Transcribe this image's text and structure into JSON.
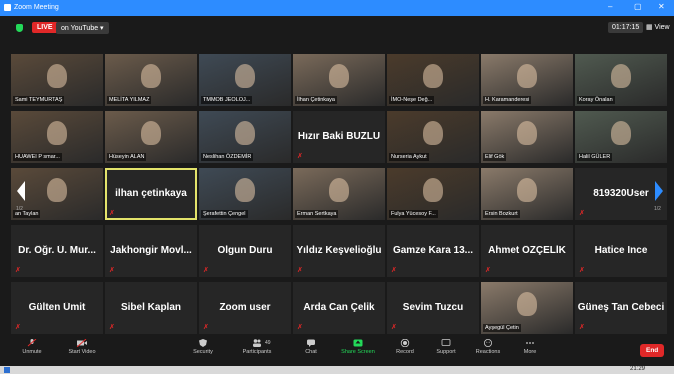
{
  "window": {
    "title": "Zoom Meeting"
  },
  "topbar": {
    "live": "LIVE",
    "stream": "on YouTube ▾",
    "timer": "01:17:15",
    "view": "▦ View"
  },
  "page_indicator_left": "1/2",
  "page_indicator_right": "1/2",
  "tiles": [
    {
      "name": "Sami TEYMURTAŞ",
      "photo": true
    },
    {
      "name": "MELİTA YILMAZ",
      "photo": true
    },
    {
      "name": "TMMOB JEOLOJ...",
      "photo": true
    },
    {
      "name": "İlhan Çetinkaya",
      "photo": true
    },
    {
      "name": "İMO-Neşe Değ...",
      "photo": true
    },
    {
      "name": "H. Karamanderesi",
      "photo": true
    },
    {
      "name": "Koray Önalan",
      "photo": true
    },
    {
      "name": "HUAWEI P smar...",
      "photo": true
    },
    {
      "name": "Hüseyin ALAN",
      "photo": true
    },
    {
      "name": "Neslihan ÖZDEMİR",
      "photo": true
    },
    {
      "name": "Hızır Baki BUZLU",
      "photo": false
    },
    {
      "name": "Nurseria Aykut",
      "photo": true
    },
    {
      "name": "Elif Gök",
      "photo": true
    },
    {
      "name": "Halil GÜLER",
      "photo": true
    },
    {
      "name": "an Taylan",
      "photo": true
    },
    {
      "name": "ilhan çetinkaya",
      "photo": false
    },
    {
      "name": "Şerafettin Çengel",
      "photo": true
    },
    {
      "name": "Erman Sertkaya",
      "photo": true
    },
    {
      "name": "Fulya Yücesoy F...",
      "photo": true
    },
    {
      "name": "Ersin Bozkurt",
      "photo": true
    },
    {
      "name": "819320User",
      "photo": false
    },
    {
      "name": "Dr. Öğr. Ü. Mur...",
      "photo": false
    },
    {
      "name": "Jakhongir Movl...",
      "photo": false
    },
    {
      "name": "Olgun Duru",
      "photo": false
    },
    {
      "name": "Yıldız Keşvelioğlu",
      "photo": false
    },
    {
      "name": "Gamze Kara 13...",
      "photo": false
    },
    {
      "name": "Ahmet ÖZÇELİK",
      "photo": false
    },
    {
      "name": "Hatice Ince",
      "photo": false
    },
    {
      "name": "Gülten Ümit",
      "photo": false
    },
    {
      "name": "Sibel Kaplan",
      "photo": false
    },
    {
      "name": "Zoom user",
      "photo": false
    },
    {
      "name": "Arda Can Çelik",
      "photo": false
    },
    {
      "name": "Sevim Tuzcu",
      "photo": false
    },
    {
      "name": "Ayşegül Çetin",
      "photo": true
    },
    {
      "name": "Güneş Tan Cebeci",
      "photo": false
    }
  ],
  "toolbar": {
    "unmute": "Unmute",
    "start_video": "Start Video",
    "security": "Security",
    "participants": "Participants",
    "participants_count": "49",
    "chat": "Chat",
    "share": "Share Screen",
    "record": "Record",
    "support": "Support",
    "reactions": "Reactions",
    "more": "More",
    "end": "End"
  },
  "taskbar": {
    "time": "21:29"
  },
  "colors": {
    "accent": "#2d8cff",
    "live": "#e02828",
    "share": "#23d959",
    "active_border": "#e3e36b"
  }
}
